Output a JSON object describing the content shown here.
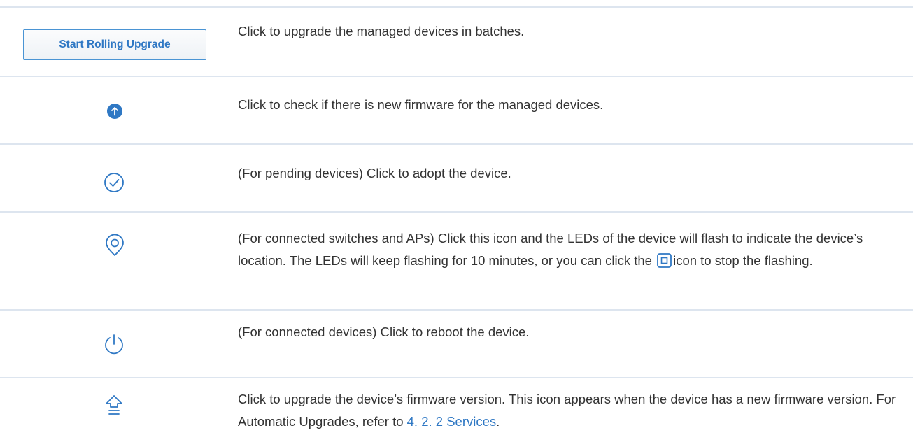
{
  "accent_color": "#2f78c4",
  "rows": [
    {
      "icon": "start-rolling-upgrade-button",
      "button_label": "Start Rolling Upgrade",
      "description": "Click to upgrade the managed devices in batches."
    },
    {
      "icon": "upload-circle-filled-icon",
      "description": "Click to check if there is new firmware for the managed devices."
    },
    {
      "icon": "check-circle-icon",
      "description": "(For pending devices) Click to adopt the device."
    },
    {
      "icon": "location-pin-icon",
      "description_part1": "(For connected switches and APs) Click this icon and the LEDs of the device will flash to indicate the device’s location. The LEDs will keep flashing for 10 minutes, or you can click the",
      "inline_icon": "stop-square-icon",
      "description_part2": "icon to stop the flashing."
    },
    {
      "icon": "power-icon",
      "description": "(For connected devices) Click to reboot the device."
    },
    {
      "icon": "upgrade-arrow-icon",
      "description_part1": "Click to upgrade the device’s firmware version. This icon appears when the device has a new firmware version. For Automatic Upgrades, refer to",
      "link_text": "4. 2. 2 Services",
      "description_part2": "."
    }
  ]
}
